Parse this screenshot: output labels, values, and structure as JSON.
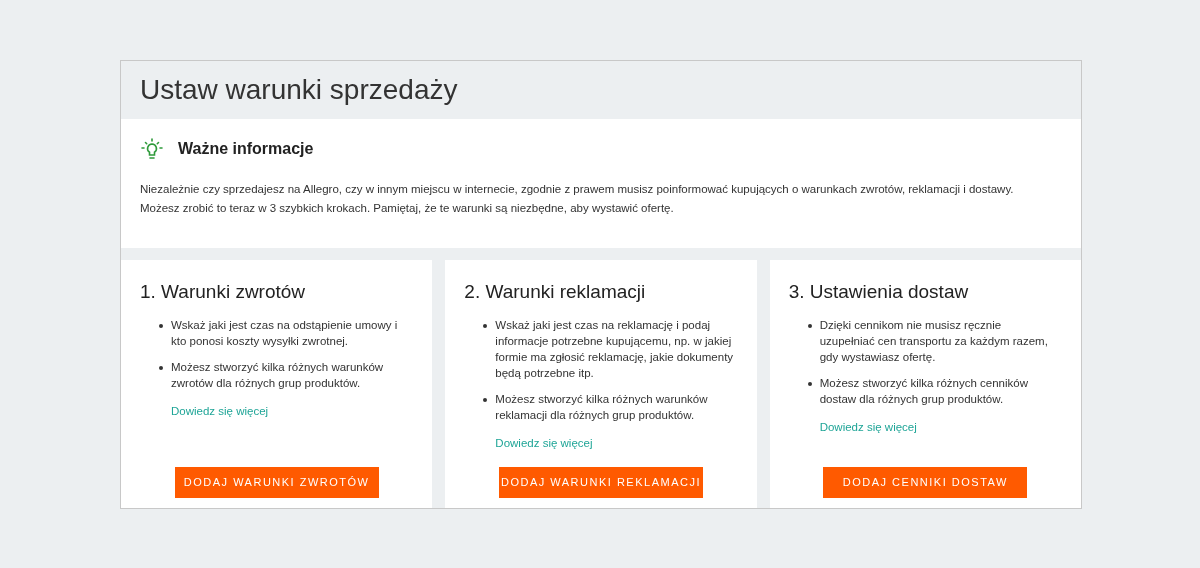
{
  "page_title": "Ustaw warunki sprzedaży",
  "info": {
    "heading": "Ważne informacje",
    "text": "Niezależnie czy sprzedajesz na Allegro, czy w innym miejscu w internecie, zgodnie z prawem musisz poinformować kupujących o warunkach zwrotów, reklamacji i dostawy. Możesz zrobić to teraz w 3 szybkich krokach. Pamiętaj, że te warunki są niezbędne, aby wystawić ofertę."
  },
  "steps": [
    {
      "title": "1. Warunki zwrotów",
      "bullets": [
        "Wskaż jaki jest czas na odstąpienie umowy i kto ponosi koszty wysyłki zwrotnej.",
        "Możesz stworzyć kilka różnych warunków zwrotów dla różnych grup produktów."
      ],
      "link": "Dowiedz się więcej",
      "button": "DODAJ WARUNKI ZWROTÓW"
    },
    {
      "title": "2. Warunki reklamacji",
      "bullets": [
        "Wskaż jaki jest czas na reklamację i podaj informacje potrzebne kupującemu, np. w jakiej formie ma zgłosić reklamację, jakie dokumenty będą potrzebne itp.",
        "Możesz stworzyć kilka różnych warunków reklamacji dla różnych grup produktów."
      ],
      "link": "Dowiedz się więcej",
      "button": "DODAJ WARUNKI REKLAMACJI"
    },
    {
      "title": "3. Ustawienia dostaw",
      "bullets": [
        "Dzięki cennikom nie musisz ręcznie uzupełniać cen transportu za każdym razem, gdy wystawiasz ofertę.",
        "Możesz stworzyć kilka różnych cenników dostaw dla różnych grup produktów."
      ],
      "link": "Dowiedz się więcej",
      "button": "DODAJ CENNIKI DOSTAW"
    }
  ]
}
